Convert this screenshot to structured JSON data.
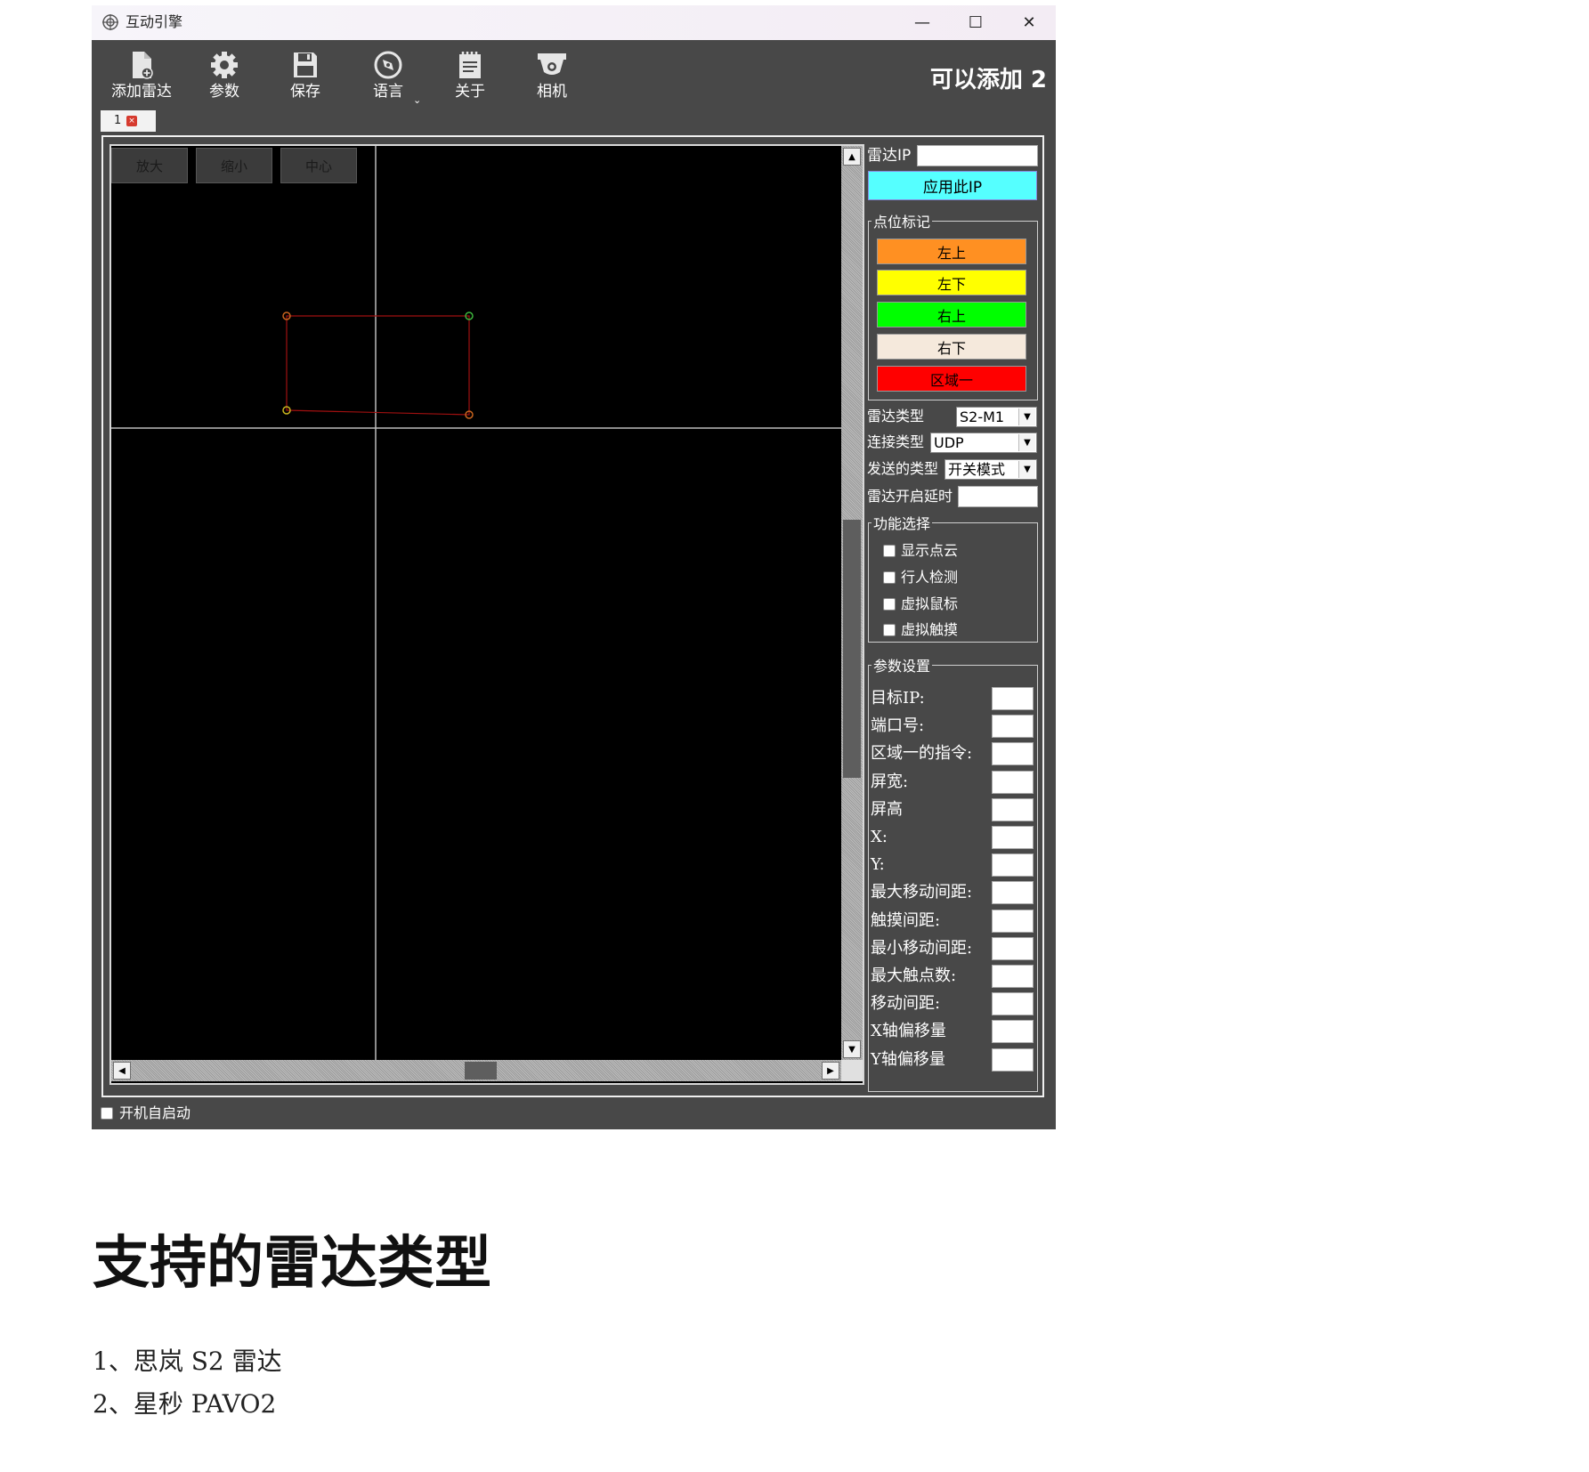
{
  "window": {
    "title": "互动引擎",
    "controls": {
      "minimize": "—",
      "maximize": "☐",
      "close": "✕"
    }
  },
  "toolbar": {
    "items": [
      {
        "label": "添加雷达",
        "icon": "add-document-icon"
      },
      {
        "label": "参数",
        "icon": "gear-icon"
      },
      {
        "label": "保存",
        "icon": "save-icon"
      },
      {
        "label": "语言",
        "icon": "compass-icon"
      },
      {
        "label": "关于",
        "icon": "notepad-icon"
      },
      {
        "label": "相机",
        "icon": "camera-icon"
      }
    ],
    "language_dropdown": "⌄",
    "add_count": "可以添加 2"
  },
  "tabs": [
    {
      "label": "1",
      "close": "×"
    }
  ],
  "canvas": {
    "buttons": [
      "放大",
      "缩小",
      "中心"
    ],
    "region_points": {
      "top_left": "#c8641e",
      "top_right": "#3cb43c",
      "bottom_left": "#c8b41e",
      "bottom_right": "#c8641e",
      "edge_color": "#a01010"
    },
    "crosshair_color": "#bcbcbc"
  },
  "right_panel": {
    "radar_ip_label": "雷达IP",
    "radar_ip_value": "",
    "apply_ip_button": "应用此IP",
    "point_marks": {
      "legend": "点位标记",
      "buttons": [
        {
          "label": "左上",
          "color": "#ff9022"
        },
        {
          "label": "左下",
          "color": "#ffff00"
        },
        {
          "label": "右上",
          "color": "#00ff00"
        },
        {
          "label": "右下",
          "color": "#f5e9dc"
        },
        {
          "label": "区域一",
          "color": "#ff0000"
        }
      ]
    },
    "radar_type": {
      "label": "雷达类型",
      "value": "S2-M1"
    },
    "connection_type": {
      "label": "连接类型",
      "value": "UDP"
    },
    "send_type": {
      "label": "发送的类型",
      "value": "开关模式"
    },
    "radar_delay": {
      "label": "雷达开启延时",
      "value": ""
    },
    "functions": {
      "legend": "功能选择",
      "options": [
        "显示点云",
        "行人检测",
        "虚拟鼠标",
        "虚拟触摸"
      ]
    },
    "params": {
      "legend": "参数设置",
      "fields": [
        "目标IP:",
        "端口号:",
        "区域一的指令:",
        "屏宽:",
        "屏高",
        "X:",
        "Y:",
        "最大移动间距:",
        "触摸间距:",
        "最小移动间距:",
        "最大触点数:",
        "移动间距:",
        "X轴偏移量",
        "Y轴偏移量"
      ]
    }
  },
  "footer": {
    "autostart_label": "开机自启动"
  },
  "document": {
    "heading": "支持的雷达类型",
    "items": [
      "1、思岚 S2 雷达",
      "2、星秒 PAVO2"
    ]
  }
}
